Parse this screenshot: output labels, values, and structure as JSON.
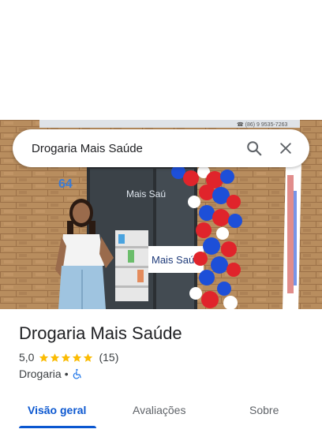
{
  "search": {
    "query": "Drogaria Mais Saúde"
  },
  "photo": {
    "banner_text": "☎ (86) 9 9535-7263",
    "house_number": "64",
    "sign_text": "Mais Saúde",
    "door_text": "Mais Saú"
  },
  "place": {
    "name": "Drogaria Mais Saúde",
    "rating": "5,0",
    "stars": 5,
    "review_count": "(15)",
    "category": "Drogaria",
    "separator": "•"
  },
  "tabs": [
    {
      "label": "Visão geral",
      "active": true
    },
    {
      "label": "Avaliações",
      "active": false
    },
    {
      "label": "Sobre",
      "active": false
    }
  ],
  "colors": {
    "accent": "#0b57d0",
    "star": "#fbbc04",
    "balloon_red": "#e0242b",
    "balloon_blue": "#1d4fd8"
  },
  "icons": {
    "search": "search-icon",
    "close": "close-icon",
    "accessibility": "wheelchair-icon"
  }
}
